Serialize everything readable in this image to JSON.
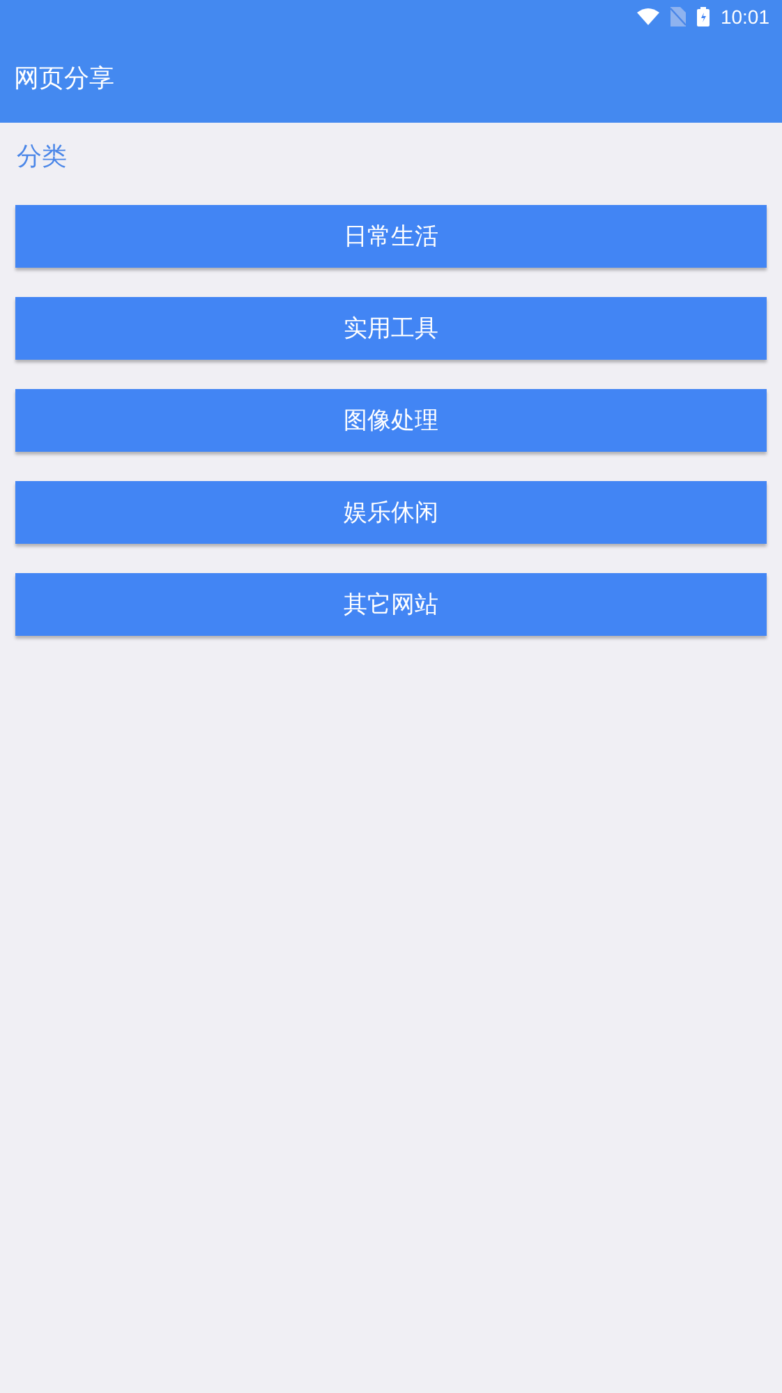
{
  "status_bar": {
    "time": "10:01"
  },
  "app_bar": {
    "title": "网页分享"
  },
  "section": {
    "title": "分类"
  },
  "categories": [
    {
      "label": "日常生活"
    },
    {
      "label": "实用工具"
    },
    {
      "label": "图像处理"
    },
    {
      "label": "娱乐休闲"
    },
    {
      "label": "其它网站"
    }
  ]
}
